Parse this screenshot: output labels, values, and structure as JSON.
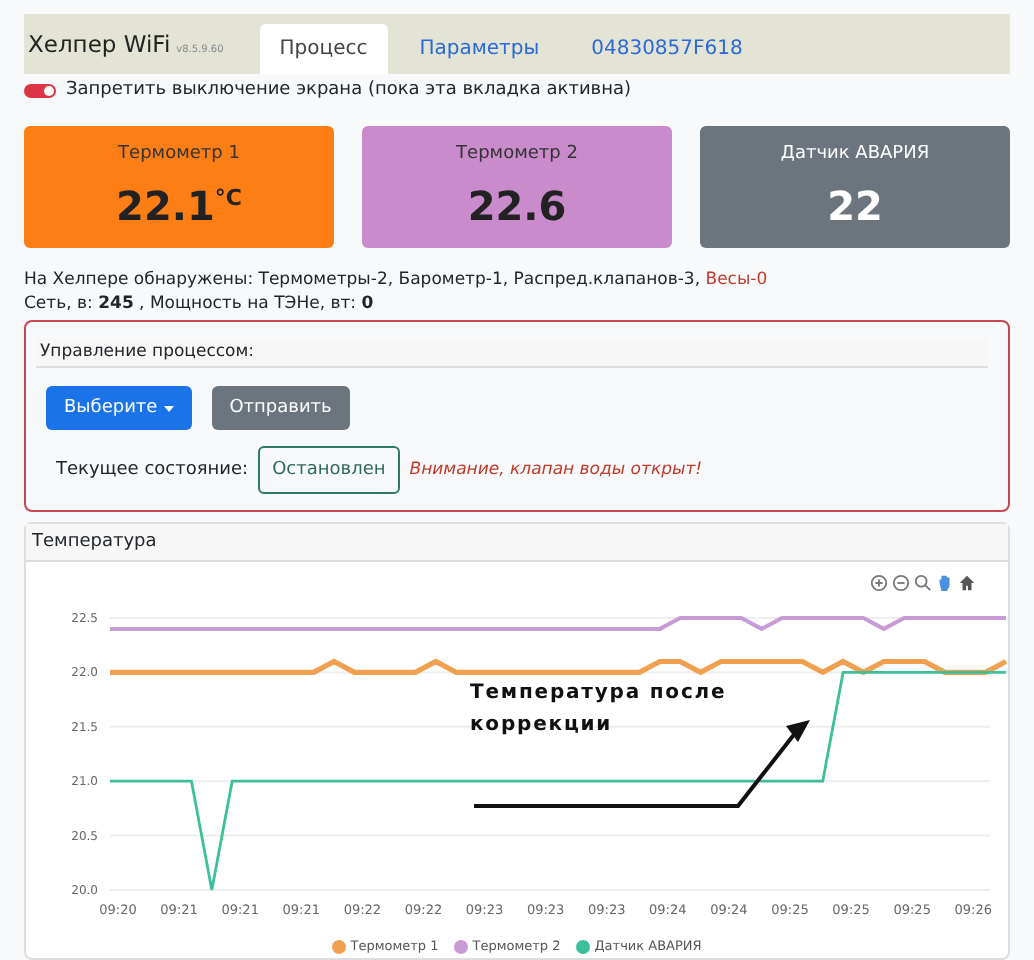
{
  "header": {
    "brand": "Хелпер WiFi",
    "version": "v8.5.9.60",
    "tabs": [
      {
        "label": "Процесс",
        "selected": true
      },
      {
        "label": "Параметры",
        "selected": false
      },
      {
        "label": "04830857F618",
        "selected": false
      }
    ]
  },
  "screen_lock": {
    "label": "Запретить выключение экрана (пока эта вкладка активна)",
    "on": true
  },
  "cards": [
    {
      "title": "Термометр 1",
      "value": "22.1",
      "unit": "°C",
      "color": "#fd7e14"
    },
    {
      "title": "Термометр 2",
      "value": "22.6",
      "color": "#c98bcc"
    },
    {
      "title": "Датчик АВАРИЯ",
      "value": "22",
      "color": "#6c757d"
    }
  ],
  "detected": {
    "label": "На Хелпере обнаружены: Термометры-2, Барометр-1, Распред.клапанов-3, ",
    "alert": "Весы-0"
  },
  "power": "Сеть, в: **245** , Мощность на ТЭНе, вт: **0**",
  "control": {
    "title": "Управление процессом:",
    "select_button": "Выберите",
    "send_button": "Отправить",
    "state_label": "Текущее состояние:",
    "state": "Остановлен",
    "warning": "Внимание, клапан воды открыт!"
  },
  "chart_panel": {
    "title": "Температура",
    "chart_data": {
      "type": "line",
      "categories": [
        "09:20",
        null,
        null,
        "09:21",
        null,
        null,
        "09:21",
        null,
        null,
        "09:21",
        null,
        null,
        "09:22",
        null,
        null,
        "09:22",
        null,
        null,
        "09:23",
        null,
        null,
        "09:23",
        null,
        null,
        "09:23",
        null,
        null,
        "09:24",
        null,
        null,
        "09:24",
        null,
        null,
        "09:25",
        null,
        null,
        "09:25",
        null,
        null,
        "09:25",
        null,
        null,
        "09:26",
        null,
        null
      ],
      "grid": true,
      "ylim": [
        20,
        22.5
      ],
      "yticks": [
        {
          "value": 20,
          "label": "20.0"
        },
        {
          "value": 20.5,
          "label": "20.5"
        },
        {
          "value": 21,
          "label": "21.0"
        },
        {
          "value": 21.5,
          "label": "21.5"
        },
        {
          "value": 22,
          "label": "22.0"
        },
        {
          "value": 22.5,
          "label": "22.5"
        }
      ],
      "series": [
        {
          "name": "Термометр 1",
          "color": "#f0a050",
          "values": [
            22,
            22,
            22,
            22,
            22,
            22,
            22,
            22,
            22,
            22,
            22,
            22.1,
            22,
            22,
            22,
            22,
            22.1,
            22,
            22,
            22,
            22,
            22,
            22,
            22,
            22,
            22,
            22,
            22.1,
            22.1,
            22,
            22.1,
            22.1,
            22.1,
            22.1,
            22.1,
            22,
            22.1,
            22,
            22.1,
            22.1,
            22.1,
            22,
            22,
            22,
            22.1
          ]
        },
        {
          "name": "Термометр 2",
          "color": "#c99bd6",
          "values": [
            22.4,
            22.4,
            22.4,
            22.4,
            22.4,
            22.4,
            22.4,
            22.4,
            22.4,
            22.4,
            22.4,
            22.4,
            22.4,
            22.4,
            22.4,
            22.4,
            22.4,
            22.4,
            22.4,
            22.4,
            22.4,
            22.4,
            22.4,
            22.4,
            22.4,
            22.4,
            22.4,
            22.4,
            22.5,
            22.5,
            22.5,
            22.5,
            22.4,
            22.5,
            22.5,
            22.5,
            22.5,
            22.5,
            22.4,
            22.5,
            22.5,
            22.5,
            22.5,
            22.5,
            22.5
          ]
        },
        {
          "name": "Датчик АВАРИЯ",
          "color": "#3cbf9a",
          "values": [
            21,
            21,
            21,
            21,
            21,
            20,
            21,
            21,
            21,
            21,
            21,
            21,
            21,
            21,
            21,
            21,
            21,
            21,
            21,
            21,
            21,
            21,
            21,
            21,
            21,
            21,
            21,
            21,
            21,
            21,
            21,
            21,
            21,
            21,
            21,
            21,
            22,
            22,
            22,
            22,
            22,
            22,
            22,
            22,
            22
          ]
        }
      ],
      "annotations": [
        {
          "text": "Температура после коррекции"
        }
      ]
    }
  }
}
